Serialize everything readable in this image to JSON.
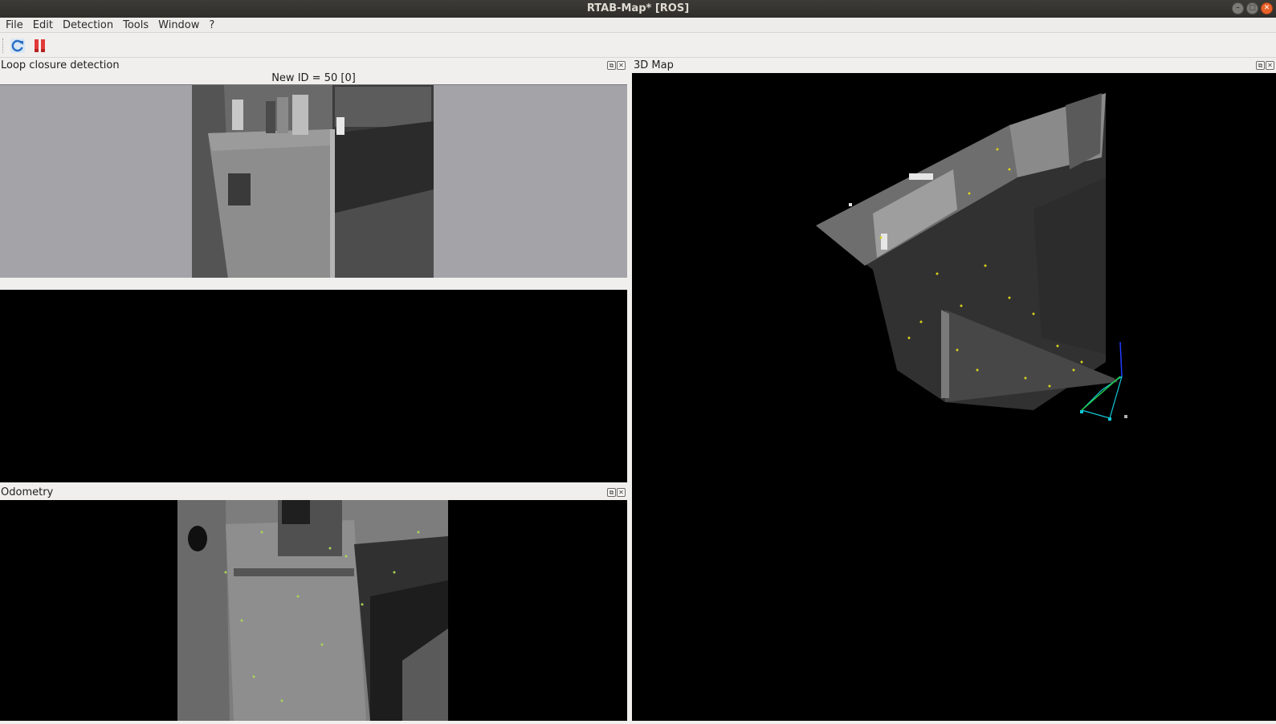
{
  "window": {
    "title": "RTAB-Map* [ROS]"
  },
  "menubar": {
    "items": [
      "File",
      "Edit",
      "Detection",
      "Tools",
      "Window",
      "?"
    ]
  },
  "toolbar": {
    "buttons": [
      "refresh-icon",
      "pause-icon"
    ]
  },
  "loop_closure": {
    "title": "Loop closure detection",
    "new_id_label": "New ID = 50 [0]"
  },
  "map3d": {
    "title": "3D Map"
  },
  "odometry": {
    "title": "Odometry"
  },
  "colors": {
    "titlebar": "#3c3b37",
    "panel_gray": "#a4a3a8",
    "point_yellow": "#d8d21c",
    "trajectory": "#13c8d8",
    "axis_blue": "#1f3cff"
  }
}
